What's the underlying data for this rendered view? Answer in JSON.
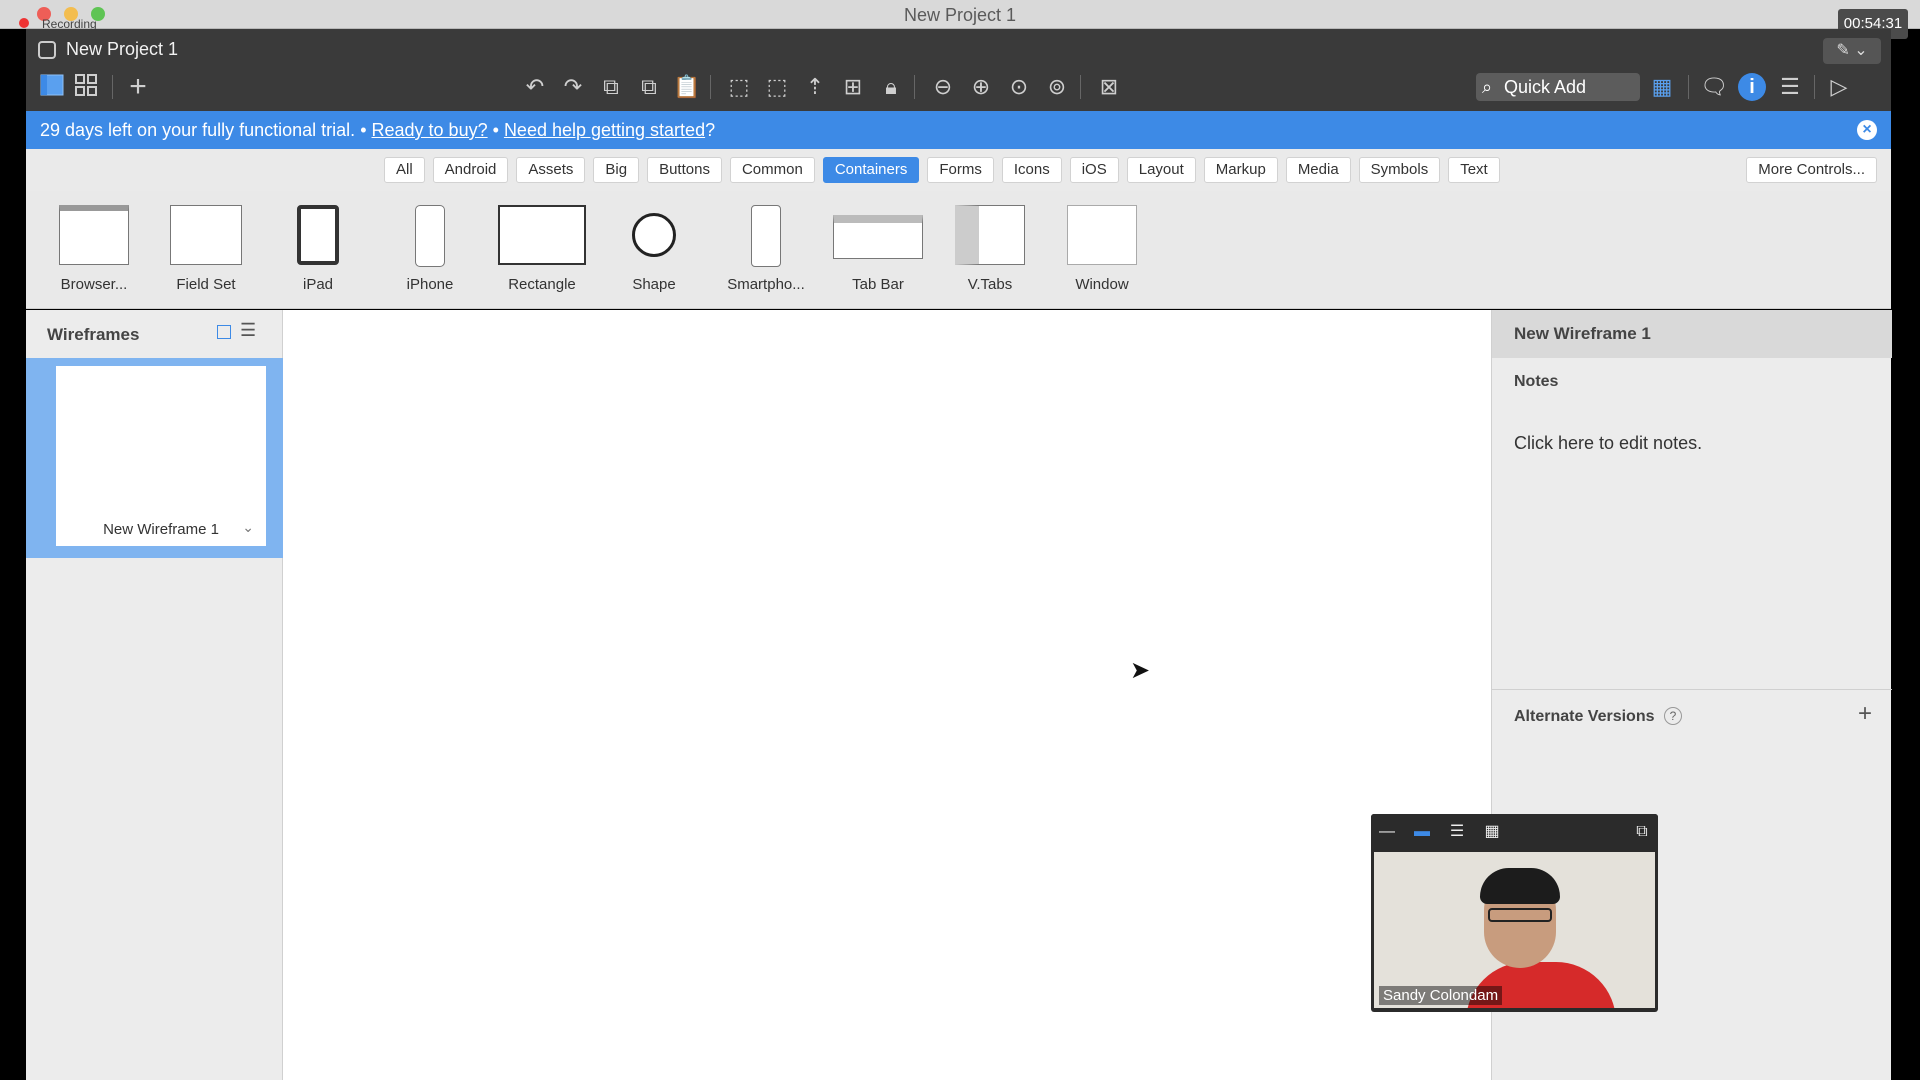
{
  "system": {
    "window_title": "New Project 1",
    "recording_label": "Recording",
    "timer": "00:54:31"
  },
  "header": {
    "project_title": "New Project 1",
    "quick_add": "Quick Add"
  },
  "trial": {
    "text": "29 days left on your fully functional trial.",
    "bullet": "•",
    "buy_link": "Ready to buy?",
    "help_link": "Need help getting started",
    "help_suffix": "?"
  },
  "filters": {
    "tabs": [
      "All",
      "Android",
      "Assets",
      "Big",
      "Buttons",
      "Common",
      "Containers",
      "Forms",
      "Icons",
      "iOS",
      "Layout",
      "Markup",
      "Media",
      "Symbols",
      "Text"
    ],
    "active": "Containers",
    "more": "More Controls..."
  },
  "library": {
    "items": [
      "Browser...",
      "Field Set",
      "iPad",
      "iPhone",
      "Rectangle",
      "Shape",
      "Smartpho...",
      "Tab Bar",
      "V.Tabs",
      "Window"
    ]
  },
  "left_panel": {
    "title": "Wireframes",
    "wireframe_name": "New Wireframe 1"
  },
  "right_panel": {
    "title": "New Wireframe 1",
    "notes_label": "Notes",
    "notes_placeholder": "Click here to edit notes.",
    "alt_versions": "Alternate Versions",
    "alt_help": "?"
  },
  "video": {
    "participant_name": "Sandy Colondam"
  },
  "colors": {
    "accent": "#3d8ae6",
    "header_bg": "#3a3a3a"
  }
}
